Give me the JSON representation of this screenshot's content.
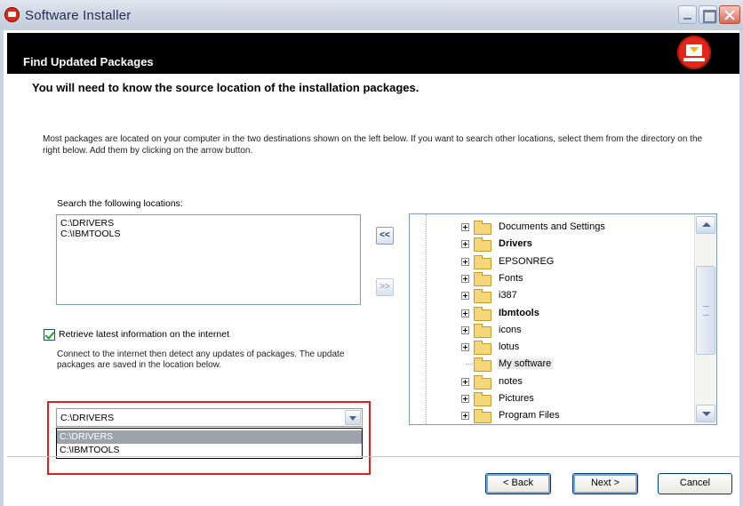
{
  "window": {
    "title": "Software Installer"
  },
  "header": {
    "heading": "Find Updated Packages",
    "icon": "download-icon"
  },
  "subheading": "You will need to know the source location of the installation packages.",
  "info_text": "Most packages are located on your computer in the two destinations shown on the left below.  If you want to search other locations, select them from the directory on the right below.  Add them by clicking on the arrow button.",
  "search": {
    "label": "Search the following locations:",
    "locations": [
      "C:\\DRIVERS",
      "C:\\IBMTOOLS"
    ]
  },
  "arrows": {
    "add": "<<",
    "remove": ">>"
  },
  "tree": {
    "items": [
      {
        "label": "Documents and Settings",
        "bold": false,
        "expandable": true,
        "selected": false
      },
      {
        "label": "Drivers",
        "bold": true,
        "expandable": true,
        "selected": false
      },
      {
        "label": "EPSONREG",
        "bold": false,
        "expandable": true,
        "selected": false
      },
      {
        "label": "Fonts",
        "bold": false,
        "expandable": true,
        "selected": false
      },
      {
        "label": "i387",
        "bold": false,
        "expandable": true,
        "selected": false
      },
      {
        "label": "Ibmtools",
        "bold": true,
        "expandable": true,
        "selected": false
      },
      {
        "label": "icons",
        "bold": false,
        "expandable": true,
        "selected": false
      },
      {
        "label": "lotus",
        "bold": false,
        "expandable": true,
        "selected": false
      },
      {
        "label": "My software",
        "bold": false,
        "expandable": false,
        "selected": true
      },
      {
        "label": "notes",
        "bold": false,
        "expandable": true,
        "selected": false
      },
      {
        "label": "Pictures",
        "bold": false,
        "expandable": true,
        "selected": false
      },
      {
        "label": "Program Files",
        "bold": false,
        "expandable": true,
        "selected": false
      }
    ]
  },
  "internet": {
    "checkbox_label": "Retrieve latest information on the internet",
    "checked": true,
    "description": "Connect to the internet then detect any updates of packages.  The update packages are saved in the location below."
  },
  "location_combo": {
    "value": "C:\\DRIVERS",
    "options": [
      "C:\\DRIVERS",
      "C:\\IBMTOOLS"
    ]
  },
  "buttons": {
    "back": "< Back",
    "next": "Next >",
    "cancel": "Cancel"
  }
}
